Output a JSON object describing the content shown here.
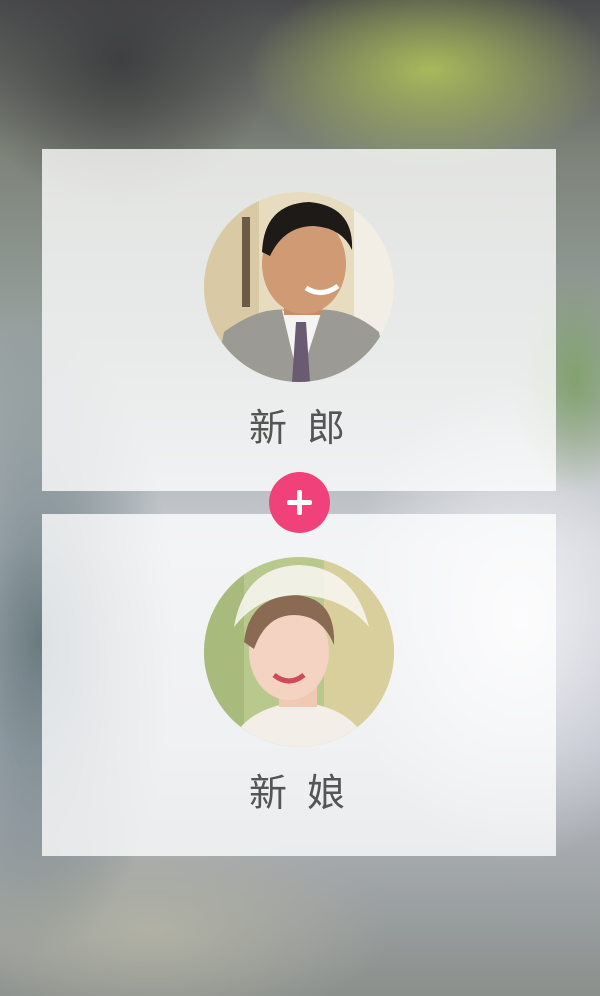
{
  "groom": {
    "label": "新 郎",
    "avatar_icon": "groom-avatar-photo"
  },
  "bride": {
    "label": "新 娘",
    "avatar_icon": "bride-avatar-photo"
  },
  "plus_button": {
    "icon": "plus-icon",
    "color": "#f0417a"
  }
}
